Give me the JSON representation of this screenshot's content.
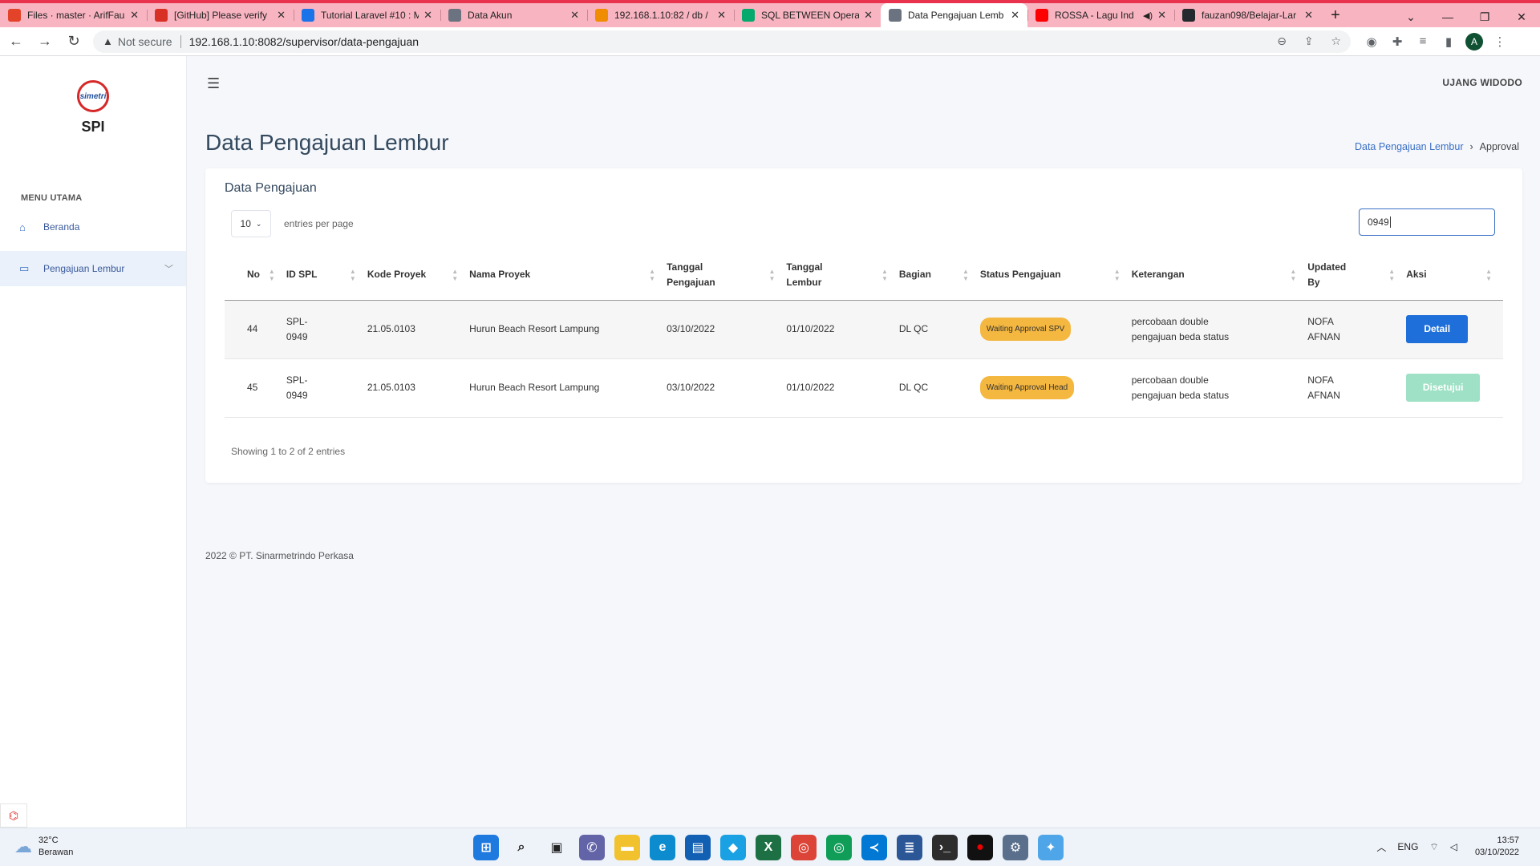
{
  "browser": {
    "tabs": [
      {
        "label": "Files · master · ArifFauz",
        "color": "#e24329",
        "active": false
      },
      {
        "label": "[GitHub] Please verify",
        "color": "#d93025",
        "active": false
      },
      {
        "label": "Tutorial Laravel #10 : M",
        "color": "#1a73e8",
        "active": false
      },
      {
        "label": "Data Akun",
        "color": "#6b7280",
        "active": false
      },
      {
        "label": "192.168.1.10:82 / db / ",
        "color": "#f08c00",
        "active": false
      },
      {
        "label": "SQL BETWEEN Operat",
        "color": "#04aa6d",
        "active": false
      },
      {
        "label": "Data Pengajuan Lemb",
        "color": "#6b7280",
        "active": true
      },
      {
        "label": "ROSSA - Lagu Ind",
        "color": "#ff0000",
        "active": false
      },
      {
        "label": "fauzan098/Belajar-Lar",
        "color": "#24292f",
        "active": false
      }
    ],
    "not_secure": "Not secure",
    "url": "192.168.1.10:8082/supervisor/data-pengajuan",
    "profile_initial": "A"
  },
  "sidebar": {
    "logo_text": "simetri",
    "brand": "SPI",
    "menu_title": "MENU UTAMA",
    "items": [
      {
        "label": "Beranda"
      },
      {
        "label": "Pengajuan Lembur"
      }
    ]
  },
  "header": {
    "user_name": "UJANG WIDODO"
  },
  "page": {
    "title": "Data Pengajuan Lembur",
    "breadcrumb": [
      "Data Pengajuan Lembur",
      "Approval"
    ]
  },
  "card": {
    "title": "Data Pengajuan",
    "entries_value": "10",
    "entries_label": "entries per page",
    "search_value": "0949",
    "columns": [
      "No",
      "ID SPL",
      "Kode Proyek",
      "Nama Proyek",
      "Tanggal Pengajuan",
      "Tanggal Lembur",
      "Bagian",
      "Status Pengajuan",
      "Keterangan",
      "Updated By",
      "Aksi"
    ],
    "rows": [
      {
        "no": "44",
        "id_spl": "SPL-0949",
        "kode": "21.05.0103",
        "proyek": "Hurun Beach Resort Lampung",
        "tgl_pengajuan": "03/10/2022",
        "tgl_lembur": "01/10/2022",
        "bagian": "DL QC",
        "status": "Waiting Approval SPV",
        "keterangan": "percobaan double pengajuan beda status",
        "updated_by": "NOFA AFNAN",
        "aksi": "Detail"
      },
      {
        "no": "45",
        "id_spl": "SPL-0949",
        "kode": "21.05.0103",
        "proyek": "Hurun Beach Resort Lampung",
        "tgl_pengajuan": "03/10/2022",
        "tgl_lembur": "01/10/2022",
        "bagian": "DL QC",
        "status": "Waiting Approval Head",
        "keterangan": "percobaan double pengajuan beda status",
        "updated_by": "NOFA AFNAN",
        "aksi": "Disetujui"
      }
    ],
    "showing": "Showing 1 to 2 of 2 entries"
  },
  "footer": "2022 © PT. Sinarmetrindo Perkasa",
  "taskbar": {
    "temp": "32°C",
    "weather": "Berawan",
    "lang": "ENG",
    "time": "13:57",
    "date": "03/10/2022"
  },
  "colors": {
    "primary": "#1e6fd9",
    "badge": "#f4b740",
    "approved": "#9fe1c6",
    "tabbar": "#f8b4c0"
  }
}
